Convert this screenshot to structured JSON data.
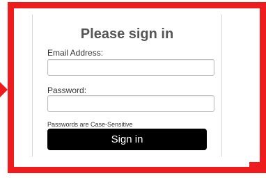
{
  "form": {
    "title": "Please sign in",
    "email_label": "Email Address:",
    "email_value": "",
    "password_label": "Password:",
    "password_value": "",
    "note": "Passwords are Case-Sensitive",
    "submit_label": "Sign in"
  },
  "colors": {
    "highlight": "#ee1c1c",
    "button_bg": "#000000",
    "title_text": "#555555"
  }
}
